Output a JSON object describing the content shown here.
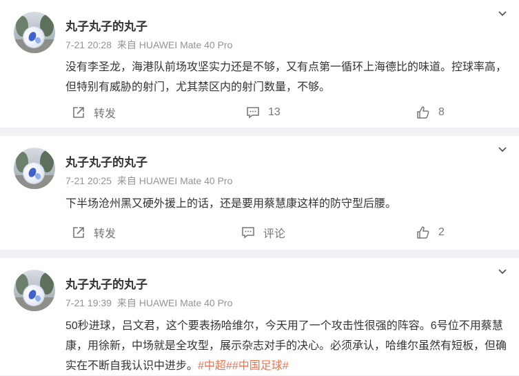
{
  "posts": [
    {
      "author": "丸子丸子的丸子",
      "time": "7-21 20:28",
      "source": "来自 HUAWEI Mate 40 Pro",
      "text": "没有李圣龙，海港队前场攻坚实力还是不够，又有点第一循环上海德比的味道。控球率高，但特别有威胁的射门，尤其禁区内的射门数量，不够。",
      "forward_label": "转发",
      "comment_label": "13",
      "like_label": "8"
    },
    {
      "author": "丸子丸子的丸子",
      "time": "7-21 20:25",
      "source": "来自 HUAWEI Mate 40 Pro",
      "text": "下半场沧州黑又硬外援上的话，还是要用蔡慧康这样的防守型后腰。",
      "forward_label": "转发",
      "comment_label": "评论",
      "like_label": "2"
    },
    {
      "author": "丸子丸子的丸子",
      "time": "7-21 19:39",
      "source": "来自 HUAWEI Mate 40 Pro",
      "text": "50秒进球，吕文君，这个要表扬哈维尔，今天用了一个攻击性很强的阵容。6号位不用蔡慧康，用徐新，中场就是全攻型，展示杂志对手的决心。必须承认，哈维尔虽然有短板，但确实在不断自我认识中进步。",
      "tags": "#中超##中国足球#"
    }
  ],
  "icons": {
    "more": "chevron-down-icon",
    "forward": "share-icon",
    "comment": "comment-icon",
    "like": "thumbs-up-icon"
  },
  "colors": {
    "tag": "#eb7350",
    "meta": "#939393",
    "background": "#f0f1f4"
  }
}
